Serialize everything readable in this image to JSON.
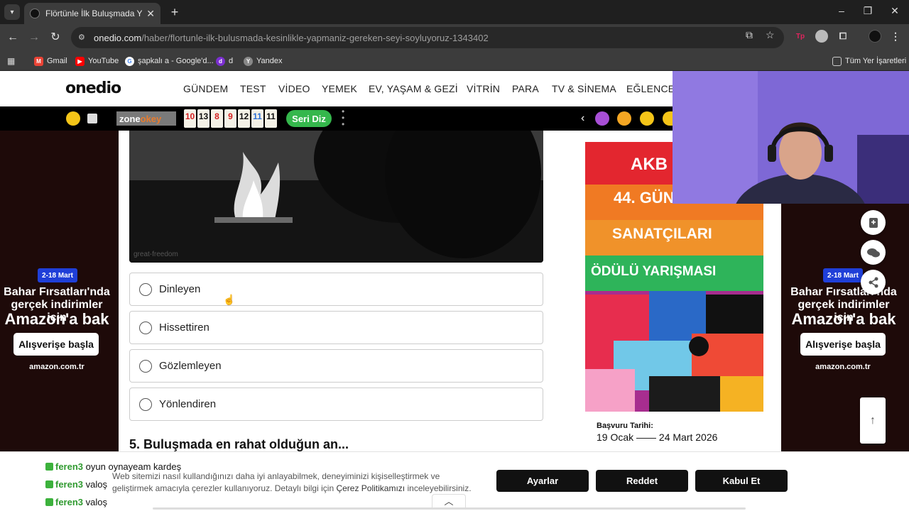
{
  "browser": {
    "tab_title": "Flörtünle İlk Buluşmada Yapmanız",
    "url_host": "onedio.com",
    "url_path": "/haber/flortunle-ilk-bulusmada-kesinlikle-yapmaniz-gereken-seyi-soyluyoruz-1343402",
    "bookmarks": [
      {
        "label": "Gmail",
        "icon": "gmail-icon",
        "color": "#ea4335"
      },
      {
        "label": "YouTube",
        "icon": "youtube-icon",
        "color": "#ff0000"
      },
      {
        "label": "şapkalı a - Google'd...",
        "icon": "google-icon",
        "color": "#4285f4"
      },
      {
        "label": "d",
        "icon": "d-site-icon",
        "color": "#7b2fd0"
      },
      {
        "label": "Yandex",
        "icon": "yandex-icon",
        "color": "#888888"
      }
    ],
    "all_bookmarks": "Tüm Yer İşaretleri"
  },
  "site": {
    "logo": "onedio",
    "nav": [
      "GÜNDEM",
      "TEST",
      "VİDEO",
      "YEMEK",
      "EV, YAŞAM & GEZİ",
      "VİTRİN",
      "PARA",
      "TV & SİNEMA",
      "EĞLENCE"
    ]
  },
  "gamebar": {
    "brand_zone": "zone",
    "brand_okey": "okey",
    "tiles": [
      {
        "n": "10",
        "color": "#d32020"
      },
      {
        "n": "13",
        "color": "#111111"
      },
      {
        "n": "8",
        "color": "#d32020"
      },
      {
        "n": "9",
        "color": "#d32020"
      },
      {
        "n": "12",
        "color": "#111111"
      },
      {
        "n": "11",
        "color": "#2a6fd6"
      },
      {
        "n": "11",
        "color": "#111111"
      }
    ],
    "cta": "Seri Diz"
  },
  "side_ad": {
    "badge": "2-18 Mart",
    "line1": "Bahar Fırsatları'nda",
    "line2": "gerçek indirimler için",
    "line3": "Amazon'a bak",
    "button": "Alışverişe başla",
    "brand": "amazon.com.tr"
  },
  "article": {
    "photo_credit": "great-freedom",
    "options": [
      "Dinleyen",
      "Hissettiren",
      "Gözlemleyen",
      "Yönlendiren"
    ],
    "next_question": "5. Buluşmada en rahat olduğun an..."
  },
  "poster": {
    "line1": "AKB",
    "line2": "44. GÜN",
    "line3": "SANATÇILARI",
    "line4": "ÖDÜLÜ YARIŞMASI",
    "date_label": "Başvuru Tarihi:",
    "date_value": "19 Ocak —— 24 Mart 2026"
  },
  "cookie": {
    "text_1": "Web sitemizi nasıl kullandığınızı daha iyi anlayabilmek, deneyiminizi kişiselleştirmek ve geliştirmek amacıyla çerezler kullanıyoruz. Detaylı bilgi için ",
    "link": "Çerez Politikamızı",
    "text_2": " inceleyebilirsiniz.",
    "settings": "Ayarlar",
    "reject": "Reddet",
    "accept": "Kabul Et"
  },
  "chat": [
    {
      "user": "feren3",
      "message": "oyun oynayeam kardeş"
    },
    {
      "user": "feren3",
      "message": "valoş"
    },
    {
      "user": "feren3",
      "message": "valoş"
    }
  ]
}
